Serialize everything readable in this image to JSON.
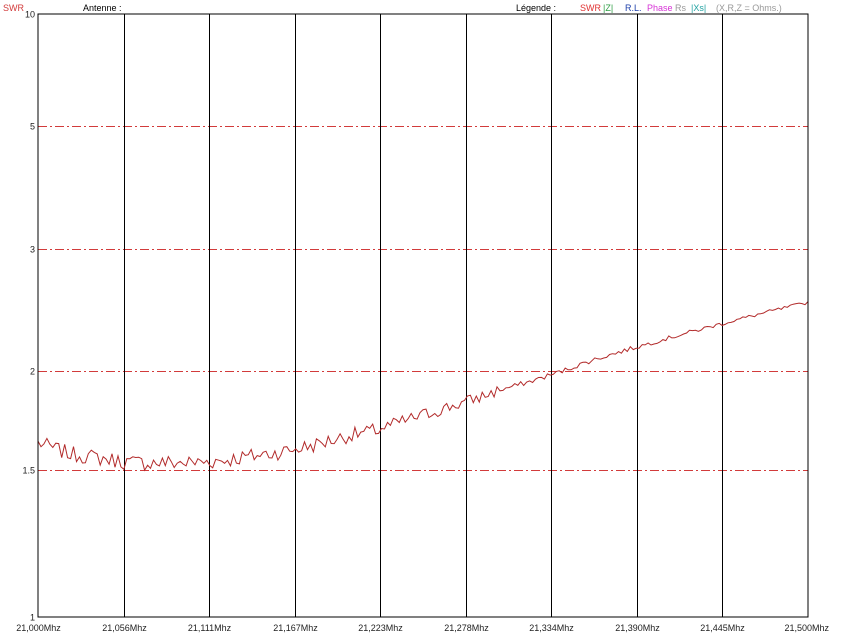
{
  "header": {
    "mode_label": "SWR",
    "antenna_label": "Antenne :",
    "legend_label": "Légende :"
  },
  "legend": [
    {
      "text": "SWR",
      "color": "#e03131",
      "name": "legend-swr"
    },
    {
      "text": "|Z|",
      "color": "#2f9e44",
      "name": "legend-z"
    },
    {
      "text": "R.L.",
      "color": "#1c3faa",
      "name": "legend-rl"
    },
    {
      "text": "Phase",
      "color": "#d633d6",
      "name": "legend-phase"
    },
    {
      "text": "Rs",
      "color": "#999999",
      "name": "legend-rs"
    },
    {
      "text": "|Xs|",
      "color": "#22a2a2",
      "name": "legend-xs"
    },
    {
      "text": "(X,R,Z = Ohms.)",
      "color": "#999999",
      "name": "legend-units"
    }
  ],
  "colors": {
    "curve": "#b22a2a",
    "grid_dashed": "#d23b3b",
    "grid_vertical": "#000000",
    "frame": "#000000"
  },
  "chart_data": {
    "type": "line",
    "title": "",
    "xlabel": "",
    "ylabel": "SWR",
    "x_unit": "Mhz",
    "xlim": [
      21.0,
      21.5
    ],
    "ylim": [
      1,
      10
    ],
    "y_scale": "reciprocal (reflection coefficient)",
    "grid": true,
    "x_ticks": [
      "21,000Mhz",
      "21,056Mhz",
      "21,111Mhz",
      "21,167Mhz",
      "21,223Mhz",
      "21,278Mhz",
      "21,334Mhz",
      "21,390Mhz",
      "21,445Mhz",
      "21,500Mhz"
    ],
    "y_ticks": [
      {
        "value": 10,
        "label": "10"
      },
      {
        "value": 5,
        "label": "5"
      },
      {
        "value": 3,
        "label": "3"
      },
      {
        "value": 2,
        "label": "2"
      },
      {
        "value": 1.5,
        "label": "1.5"
      },
      {
        "value": 1,
        "label": "1"
      }
    ],
    "series": [
      {
        "values_x": [
          21.0,
          21.02,
          21.04,
          21.06,
          21.08,
          21.1,
          21.12,
          21.14,
          21.16,
          21.18,
          21.2,
          21.22,
          21.24,
          21.26,
          21.28,
          21.3,
          21.32,
          21.34,
          21.36,
          21.38,
          21.4,
          21.42,
          21.44,
          21.46,
          21.48,
          21.5
        ],
        "values_y": [
          1.62,
          1.57,
          1.55,
          1.53,
          1.53,
          1.53,
          1.54,
          1.56,
          1.58,
          1.61,
          1.65,
          1.68,
          1.73,
          1.78,
          1.83,
          1.89,
          1.94,
          2.0,
          2.07,
          2.13,
          2.19,
          2.25,
          2.31,
          2.37,
          2.43,
          2.49
        ]
      }
    ]
  }
}
